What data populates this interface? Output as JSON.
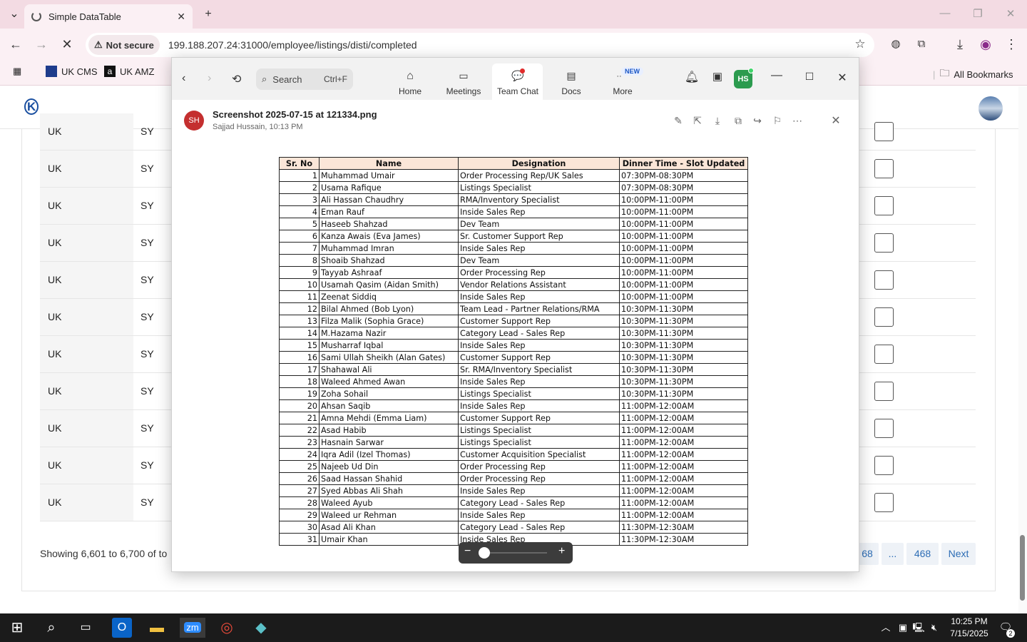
{
  "browser": {
    "tab_title": "Simple DataTable",
    "not_secure": "Not secure",
    "url": "199.188.207.24:31000/employee/listings/disti/completed",
    "bookmarks": [
      "UK CMS",
      "UK AMZ"
    ],
    "all_bookmarks": "All Bookmarks"
  },
  "page": {
    "rows": [
      {
        "c1": "UK",
        "c2": "SY"
      },
      {
        "c1": "UK",
        "c2": "SY"
      },
      {
        "c1": "UK",
        "c2": "SY"
      },
      {
        "c1": "UK",
        "c2": "SY"
      },
      {
        "c1": "UK",
        "c2": "SY"
      },
      {
        "c1": "UK",
        "c2": "SY"
      },
      {
        "c1": "UK",
        "c2": "SY"
      },
      {
        "c1": "UK",
        "c2": "SY"
      },
      {
        "c1": "UK",
        "c2": "SY"
      },
      {
        "c1": "UK",
        "c2": "SY"
      },
      {
        "c1": "UK",
        "c2": "SY"
      }
    ],
    "showing": "Showing 6,601 to 6,700 of to",
    "pagination": [
      "68",
      "...",
      "468",
      "Next"
    ]
  },
  "zoom": {
    "search_label": "Search",
    "search_shortcut": "Ctrl+F",
    "nav": [
      "Home",
      "Meetings",
      "Team Chat",
      "Docs",
      "More"
    ],
    "new_badge": "NEW",
    "user_initials": "HS",
    "file_name": "Screenshot 2025-07-15 at 121334.png",
    "file_meta": "Sajjad Hussain, 10:13 PM",
    "sender_initials": "SH"
  },
  "shot_table": {
    "headers": [
      "Sr. No",
      "Name",
      "Designation",
      "Dinner Time - Slot Updated"
    ],
    "rows": [
      [
        "1",
        "Muhammad Umair",
        "Order Processing Rep/UK Sales",
        "07:30PM-08:30PM"
      ],
      [
        "2",
        "Usama Rafique",
        "Listings Specialist",
        "07:30PM-08:30PM"
      ],
      [
        "3",
        "Ali Hassan Chaudhry",
        "RMA/Inventory Specialist",
        "10:00PM-11:00PM"
      ],
      [
        "4",
        "Eman Rauf",
        "Inside Sales Rep",
        "10:00PM-11:00PM"
      ],
      [
        "5",
        "Haseeb Shahzad",
        "Dev Team",
        "10:00PM-11:00PM"
      ],
      [
        "6",
        "Kanza Awais (Eva James)",
        "Sr. Customer Support Rep",
        "10:00PM-11:00PM"
      ],
      [
        "7",
        "Muhammad Imran",
        "Inside Sales Rep",
        "10:00PM-11:00PM"
      ],
      [
        "8",
        "Shoaib Shahzad",
        "Dev Team",
        "10:00PM-11:00PM"
      ],
      [
        "9",
        "Tayyab Ashraaf",
        "Order Processing Rep",
        "10:00PM-11:00PM"
      ],
      [
        "10",
        "Usamah Qasim (Aidan Smith)",
        "Vendor Relations Assistant",
        "10:00PM-11:00PM"
      ],
      [
        "11",
        "Zeenat Siddiq",
        "Inside Sales Rep",
        "10:00PM-11:00PM"
      ],
      [
        "12",
        "Bilal Ahmed (Bob Lyon)",
        "Team Lead - Partner Relations/RMA",
        "10:30PM-11:30PM"
      ],
      [
        "13",
        "Filza Malik (Sophia Grace)",
        "Customer Support Rep",
        "10:30PM-11:30PM"
      ],
      [
        "14",
        "M.Hazama Nazir",
        "Category Lead - Sales Rep",
        "10:30PM-11:30PM"
      ],
      [
        "15",
        "Musharraf Iqbal",
        "Inside Sales Rep",
        "10:30PM-11:30PM"
      ],
      [
        "16",
        "Sami Ullah Sheikh (Alan Gates)",
        "Customer Support Rep",
        "10:30PM-11:30PM"
      ],
      [
        "17",
        "Shahawal Ali",
        "Sr. RMA/Inventory Specialist",
        "10:30PM-11:30PM"
      ],
      [
        "18",
        "Waleed Ahmed Awan",
        "Inside Sales Rep",
        "10:30PM-11:30PM"
      ],
      [
        "19",
        "Zoha Sohail",
        "Listings Specialist",
        "10:30PM-11:30PM"
      ],
      [
        "20",
        "Ahsan Saqib",
        "Inside Sales Rep",
        "11:00PM-12:00AM"
      ],
      [
        "21",
        "Amna Mehdi (Emma Liam)",
        "Customer Support Rep",
        "11:00PM-12:00AM"
      ],
      [
        "22",
        "Asad Habib",
        "Listings Specialist",
        "11:00PM-12:00AM"
      ],
      [
        "23",
        "Hasnain Sarwar",
        "Listings Specialist",
        "11:00PM-12:00AM"
      ],
      [
        "24",
        "Iqra Adil (Izel Thomas)",
        "Customer Acquisition Specialist",
        "11:00PM-12:00AM"
      ],
      [
        "25",
        "Najeeb Ud Din",
        "Order Processing Rep",
        "11:00PM-12:00AM"
      ],
      [
        "26",
        "Saad Hassan Shahid",
        "Order Processing Rep",
        "11:00PM-12:00AM"
      ],
      [
        "27",
        "Syed Abbas Ali Shah",
        "Inside Sales Rep",
        "11:00PM-12:00AM"
      ],
      [
        "28",
        "Waleed Ayub",
        "Category Lead - Sales Rep",
        "11:00PM-12:00AM"
      ],
      [
        "29",
        "Waleed ur Rehman",
        "Inside Sales Rep",
        "11:00PM-12:00AM"
      ],
      [
        "30",
        "Asad Ali Khan",
        "Category Lead - Sales Rep",
        "11:30PM-12:30AM"
      ],
      [
        "31",
        "Umair Khan",
        "Inside Sales Rep",
        "11:30PM-12:30AM"
      ]
    ]
  },
  "taskbar": {
    "time": "10:25 PM",
    "date": "7/15/2025",
    "notif_count": "2"
  },
  "colors": {
    "tabstrip": "#f3dbe3",
    "table_header": "#fbe6d8",
    "link_blue": "#2d6db5",
    "zoom_green": "#2c9b4f"
  }
}
